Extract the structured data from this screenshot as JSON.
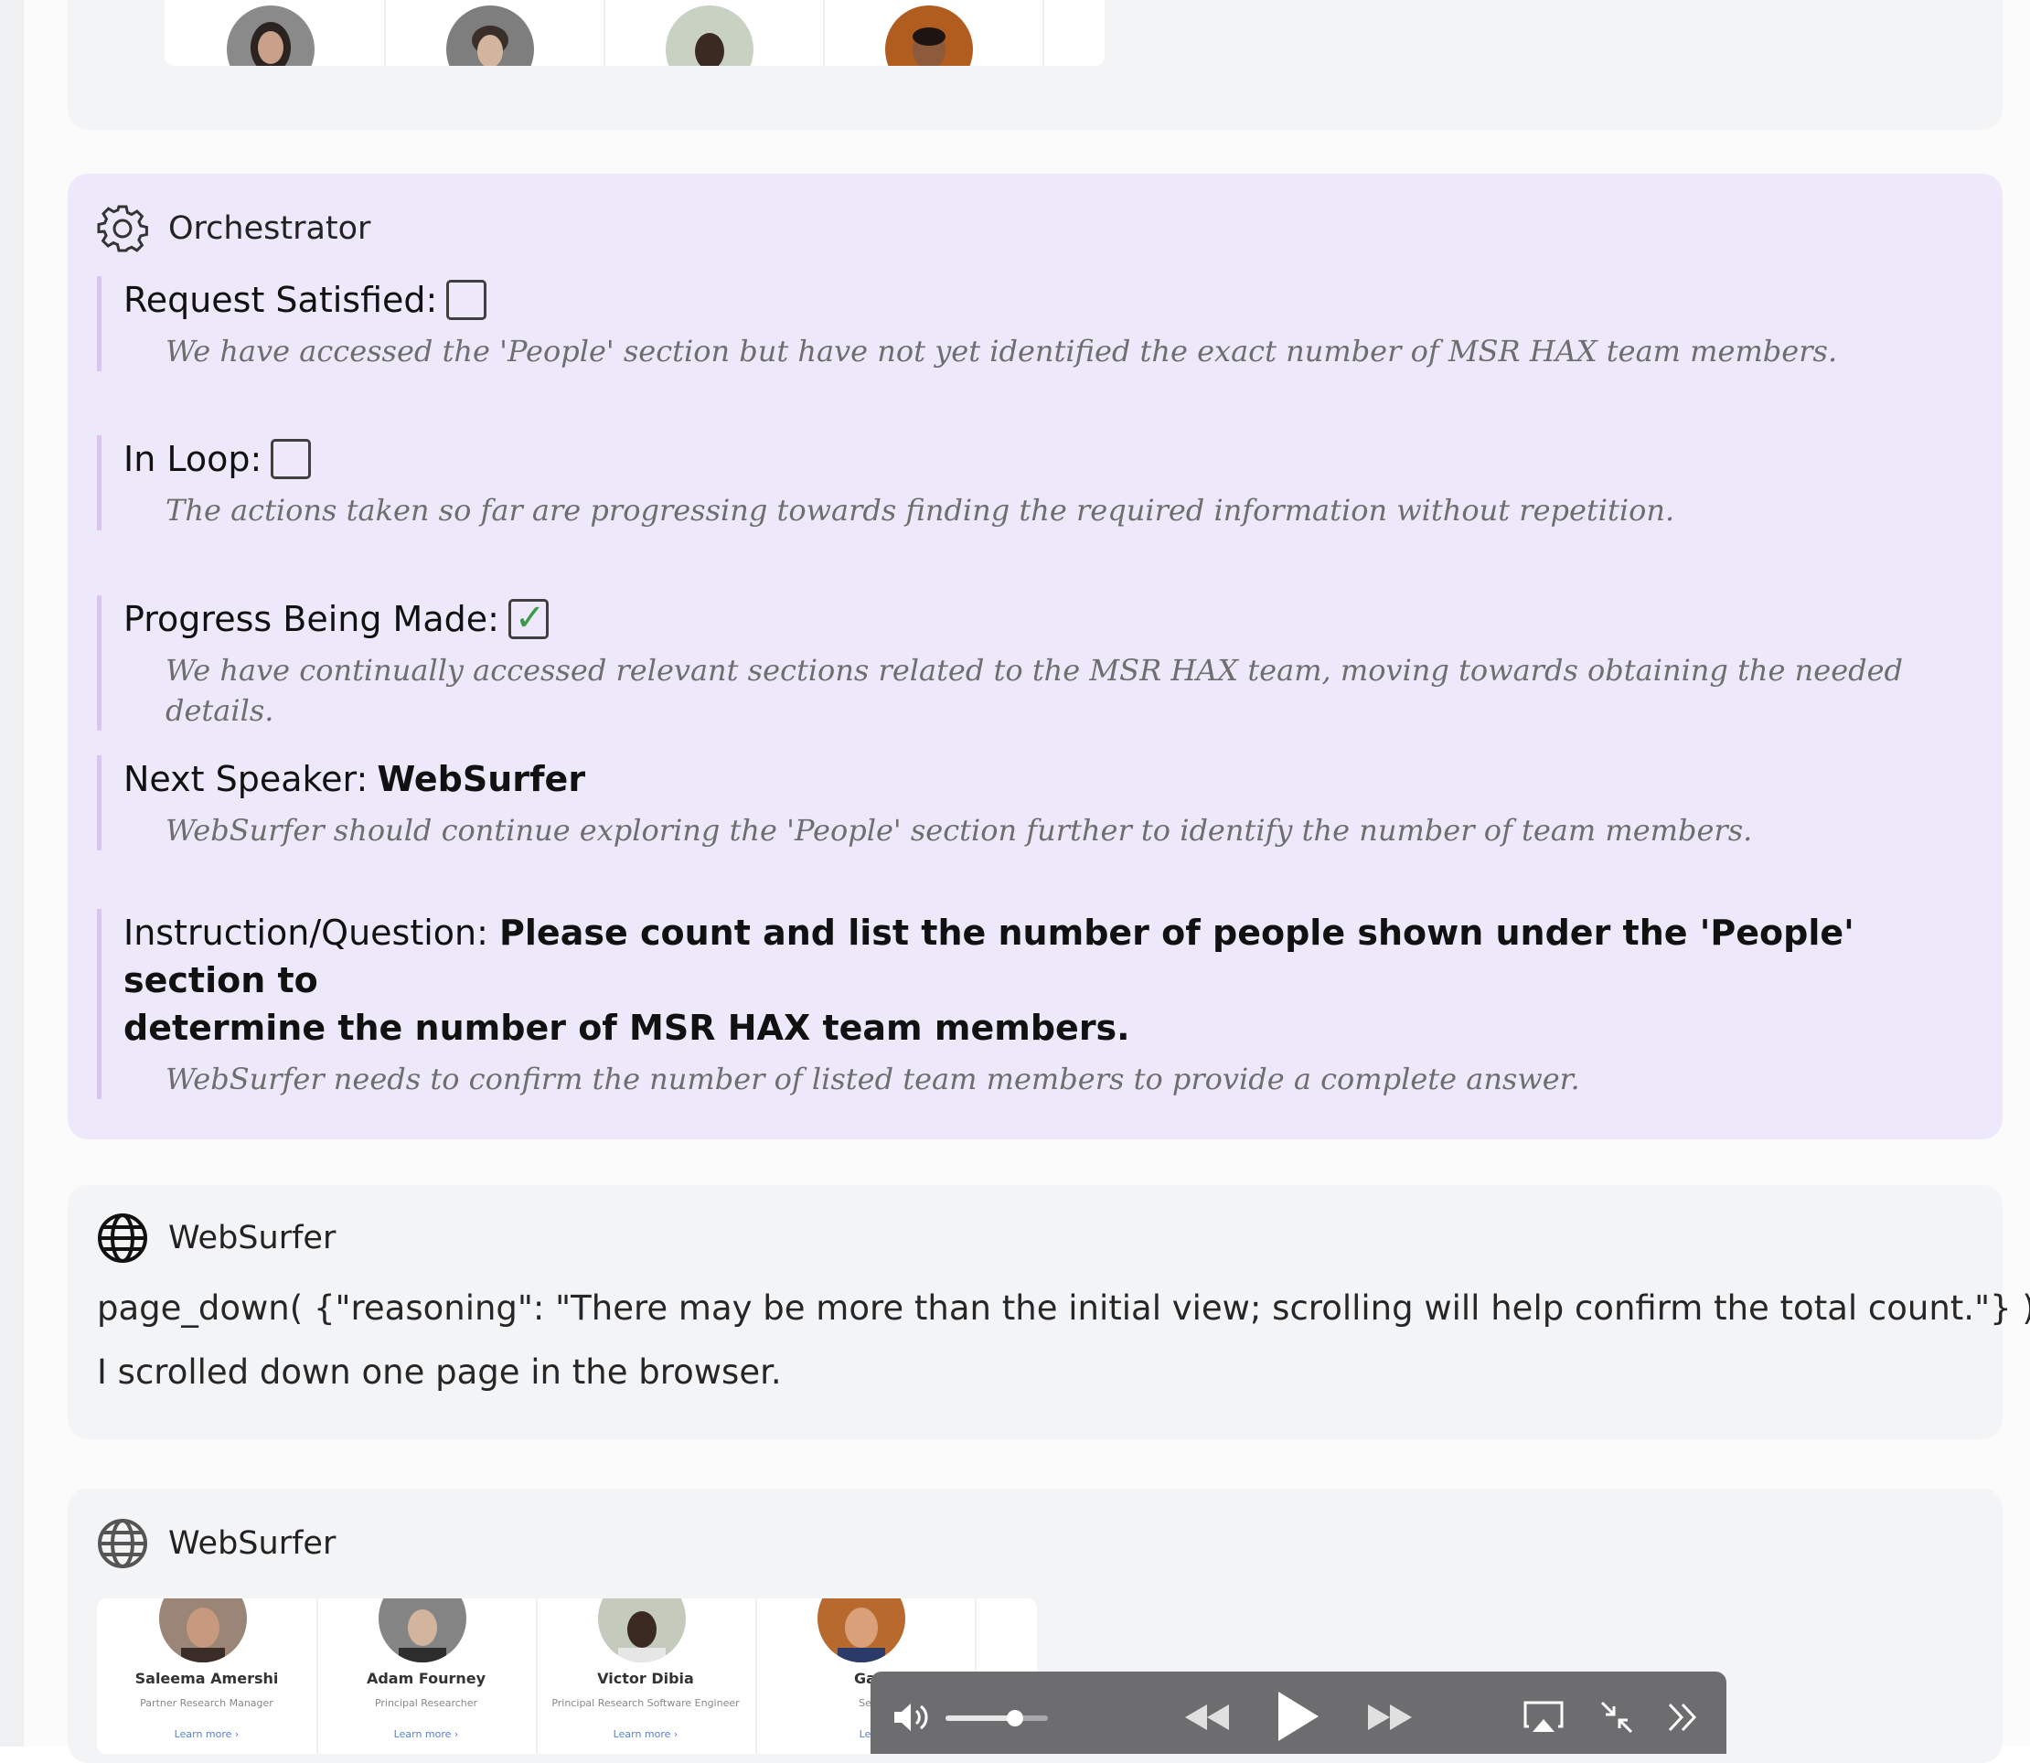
{
  "top_card": {
    "avatars": [
      "person-1",
      "person-2",
      "person-3",
      "person-4"
    ]
  },
  "orchestrator": {
    "title": "Orchestrator",
    "request_satisfied": {
      "label": "Request Satisfied:",
      "checked": false,
      "reason": "We have accessed the 'People' section but have not yet identified the exact number of MSR HAX team members."
    },
    "in_loop": {
      "label": "In Loop:",
      "checked": false,
      "reason": "The actions taken so far are progressing towards finding the required information without repetition."
    },
    "progress": {
      "label": "Progress Being Made:",
      "checked": true,
      "reason": "We have continually accessed relevant sections related to the MSR HAX team, moving towards obtaining the needed details."
    },
    "next_speaker": {
      "label": "Next Speaker:",
      "value": "WebSurfer",
      "reason": "WebSurfer should continue exploring the 'People' section further to identify the number of team members."
    },
    "instruction": {
      "label": "Instruction/Question:",
      "value_line1": "Please count and list the number of people shown under the 'People' section to",
      "value_line2": "determine the number of MSR HAX team members.",
      "reason": "WebSurfer needs to confirm the number of listed team members to provide a complete answer."
    }
  },
  "websurfer_1": {
    "title": "WebSurfer",
    "action": "page_down( {\"reasoning\": \"There may be more than the initial view; scrolling will help confirm the total count.\"} )",
    "result": "I scrolled down one page in the browser."
  },
  "websurfer_2": {
    "title": "WebSurfer",
    "people": [
      {
        "name": "Saleema Amershi",
        "role": "Partner Research Manager",
        "link": "Learn more  ›"
      },
      {
        "name": "Adam Fourney",
        "role": "Principal Researcher",
        "link": "Learn more  ›"
      },
      {
        "name": "Victor Dibia",
        "role": "Principal Research Software Engineer",
        "link": "Learn more  ›"
      },
      {
        "name": "Ga",
        "role": "Se",
        "link": "Le"
      }
    ]
  },
  "player": {
    "volume": 0.68,
    "icons": [
      "volume-icon",
      "rewind-icon",
      "play-icon",
      "fast-forward-icon",
      "airplay-icon",
      "exit-fullscreen-icon",
      "more-icon"
    ]
  },
  "colors": {
    "orchestrator_bg": "#ede9fb",
    "card_bg": "#f3f4f6",
    "section_bar": "#d9c6ef",
    "check_green": "#3a9a47"
  }
}
